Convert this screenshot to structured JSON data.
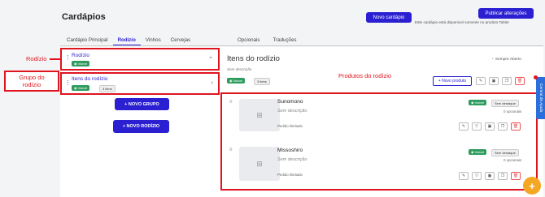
{
  "header": {
    "title": "Cardápios",
    "new_menu_button": "Novo cardápio",
    "publish_button": "Publicar alterações",
    "publish_note": "Este cardápio está disponível somente no produto Tablet"
  },
  "tabs": [
    "Cardápio Principal",
    "Rodízio",
    "Vinhos",
    "Cervejas"
  ],
  "right_tabs": [
    "Opcionais",
    "Traduções"
  ],
  "annotations": {
    "rodizio": "Rodízio",
    "grupo_line1": "Grupo do",
    "grupo_line2": "rodízio",
    "produtos": "Produtos do rodízio"
  },
  "left": {
    "rodizio_card": {
      "title": "Rodízio",
      "badge": "Visível"
    },
    "group_card": {
      "title": "Itens do rodízio",
      "badge": "Visível",
      "count": "3 itens"
    },
    "new_group_button": "+ NOVO GRUPO",
    "new_rodizio_button": "+ NOVO RODÍZIO"
  },
  "group": {
    "title": "Itens do rodízio",
    "description": "Sem descrição",
    "availability": "Sempre Aberto",
    "badge": "Visível",
    "count": "3 itens",
    "new_product_button": "+ Novo produto"
  },
  "products": [
    {
      "name": "Sunomono",
      "description": "Sem descrição",
      "limit": "Pedido ilimitado",
      "badge": "Visível",
      "highlight": "Sem destaque",
      "options": "0 opcionais"
    },
    {
      "name": "Missoshiro",
      "description": "Sem descrição",
      "limit": "Pedido ilimitado",
      "badge": "Visível",
      "highlight": "Sem destaque",
      "options": "0 opcionais"
    }
  ],
  "help_tab": "Central de Ajuda",
  "colors": {
    "accent": "#2a1fd1",
    "annotation_red": "#e0141e",
    "visible_green": "#2e9b5e",
    "fab_yellow": "#f5a623"
  }
}
